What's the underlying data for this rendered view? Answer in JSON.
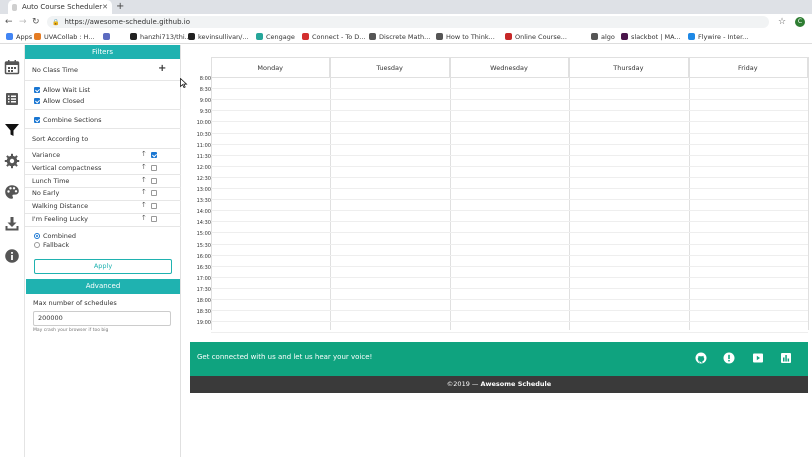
{
  "browser": {
    "tab_title": "Auto Course Scheduler",
    "new_tab": "+",
    "url": "https://awesome-schedule.github.io",
    "profile_initial": "C",
    "bookmarks": [
      {
        "label": "Apps",
        "color": "#4285f4"
      },
      {
        "label": "UVACollab : H...",
        "color": "#e57c23"
      },
      {
        "label": "",
        "color": "#5c6bc0"
      },
      {
        "label": "hanzhi713/thi...",
        "color": "#222222"
      },
      {
        "label": "kevinsullivan/...",
        "color": "#222222"
      },
      {
        "label": "Cengage",
        "color": "#26a69a"
      },
      {
        "label": "Connect - To D...",
        "color": "#d32f2f"
      },
      {
        "label": "Discrete Math...",
        "color": "#555555"
      },
      {
        "label": "How to Think...",
        "color": "#555555"
      },
      {
        "label": "Online Course...",
        "color": "#c62828"
      },
      {
        "label": "algo",
        "color": "#555555"
      },
      {
        "label": "slackbot | MA...",
        "color": "#4a154b"
      },
      {
        "label": "Flywire - Inter...",
        "color": "#1e88e5"
      }
    ]
  },
  "rail": {
    "icons": [
      "calendar-icon",
      "list-icon",
      "filter-icon",
      "settings-icon",
      "palette-icon",
      "download-icon",
      "info-icon"
    ]
  },
  "filters": {
    "header": "Filters",
    "no_class_time": "No Class Time",
    "add_symbol": "+",
    "allow_wait_list": "Allow Wait List",
    "allow_closed": "Allow Closed",
    "combine_sections": "Combine Sections",
    "sort_title": "Sort According to",
    "sort_options": [
      {
        "label": "Variance",
        "checked": true
      },
      {
        "label": "Vertical compactness",
        "checked": false
      },
      {
        "label": "Lunch Time",
        "checked": false
      },
      {
        "label": "No Early",
        "checked": false
      },
      {
        "label": "Walking Distance",
        "checked": false
      },
      {
        "label": "I'm Feeling Lucky",
        "checked": false
      }
    ],
    "arrow": "🡑",
    "mode_combined": "Combined",
    "mode_fallback": "Fallback",
    "apply": "Apply",
    "advanced": "Advanced",
    "max_label": "Max number of schedules",
    "max_value": "200000",
    "max_hint": "May crash your browser if too big"
  },
  "calendar": {
    "days": [
      "Monday",
      "Tuesday",
      "Wednesday",
      "Thursday",
      "Friday"
    ],
    "times": [
      "8:00",
      "8:30",
      "9:00",
      "9:30",
      "10:00",
      "10:30",
      "11:00",
      "11:30",
      "12:00",
      "12:30",
      "13:00",
      "13:30",
      "14:00",
      "14:30",
      "15:00",
      "15:30",
      "16:00",
      "16:30",
      "17:00",
      "17:30",
      "18:00",
      "18:30",
      "19:00"
    ]
  },
  "footer": {
    "cta": "Get connected with us and let us hear your voice!",
    "icons": [
      "github-icon",
      "alert-icon",
      "video-icon",
      "chart-icon"
    ],
    "copyright_prefix": "©2019 — ",
    "brand": "Awesome Schedule"
  },
  "colors": {
    "accent": "#1fb2b0",
    "footer_green": "#0fa37f",
    "footer_dark": "#3a3a3a"
  }
}
